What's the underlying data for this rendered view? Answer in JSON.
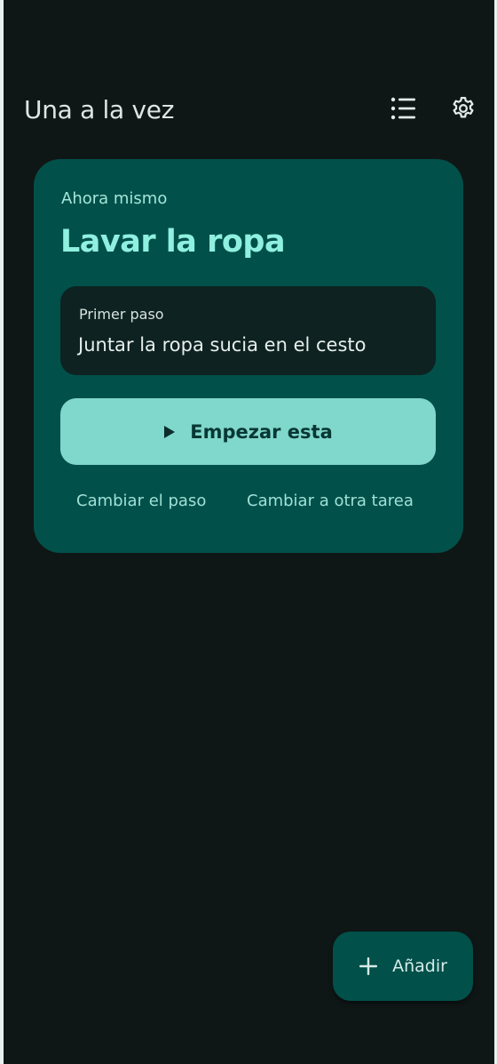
{
  "app": {
    "title": "Una a la vez"
  },
  "toolbar": {
    "list_icon": "list-icon",
    "settings_icon": "gear-icon"
  },
  "focus_card": {
    "eyebrow": "Ahora mismo",
    "task_title": "Lavar la ropa",
    "step_label": "Primer paso",
    "step_text": "Juntar la ropa sucia en el cesto",
    "start_button_label": "Empezar esta",
    "start_button_icon": "play-icon",
    "change_step_label": "Cambiar el paso",
    "change_task_label": "Cambiar a otra tarea"
  },
  "fab": {
    "label": "Añadir",
    "icon": "plus-icon"
  },
  "colors": {
    "background": "#0f1716",
    "card": "#02504a",
    "accent": "#80d7cc",
    "title_accent": "#8ff0e0"
  }
}
